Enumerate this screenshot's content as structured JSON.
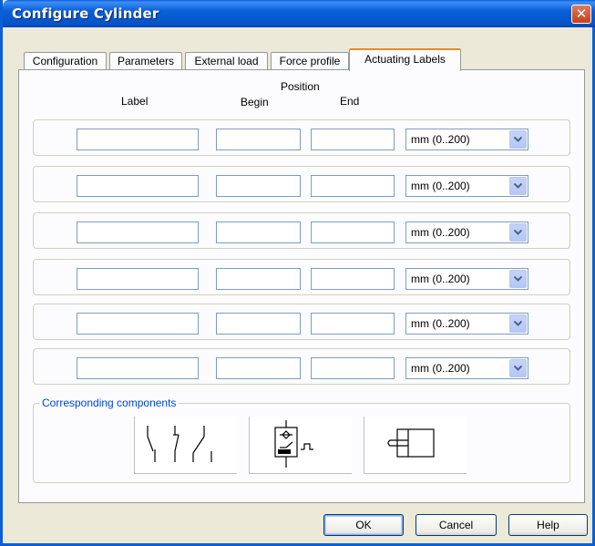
{
  "window": {
    "title": "Configure Cylinder",
    "close_glyph": "✕"
  },
  "tabs": [
    {
      "label": "Configuration"
    },
    {
      "label": "Parameters"
    },
    {
      "label": "External load"
    },
    {
      "label": "Force profile"
    },
    {
      "label": "Actuating Labels",
      "active": true
    }
  ],
  "columns": {
    "position": "Position",
    "label": "Label",
    "begin": "Begin",
    "end": "End"
  },
  "rows": [
    {
      "label": "",
      "begin": "",
      "end": "",
      "unit": "mm  (0..200)"
    },
    {
      "label": "",
      "begin": "",
      "end": "",
      "unit": "mm  (0..200)"
    },
    {
      "label": "",
      "begin": "",
      "end": "",
      "unit": "mm  (0..200)"
    },
    {
      "label": "",
      "begin": "",
      "end": "",
      "unit": "mm  (0..200)"
    },
    {
      "label": "",
      "begin": "",
      "end": "",
      "unit": "mm  (0..200)"
    },
    {
      "label": "",
      "begin": "",
      "end": "",
      "unit": "mm  (0..200)"
    }
  ],
  "components": {
    "title": "Corresponding components",
    "items": [
      {
        "icon": "switch-contacts-icon"
      },
      {
        "icon": "proximity-sensor-icon"
      },
      {
        "icon": "cylinder-icon"
      }
    ]
  },
  "buttons": {
    "ok": "OK",
    "cancel": "Cancel",
    "help": "Help"
  },
  "colors": {
    "title_bar": "#0a5fd8",
    "active_tab_accent": "#e68b2c",
    "group_title": "#0046d5",
    "close_button": "#d45a36"
  }
}
